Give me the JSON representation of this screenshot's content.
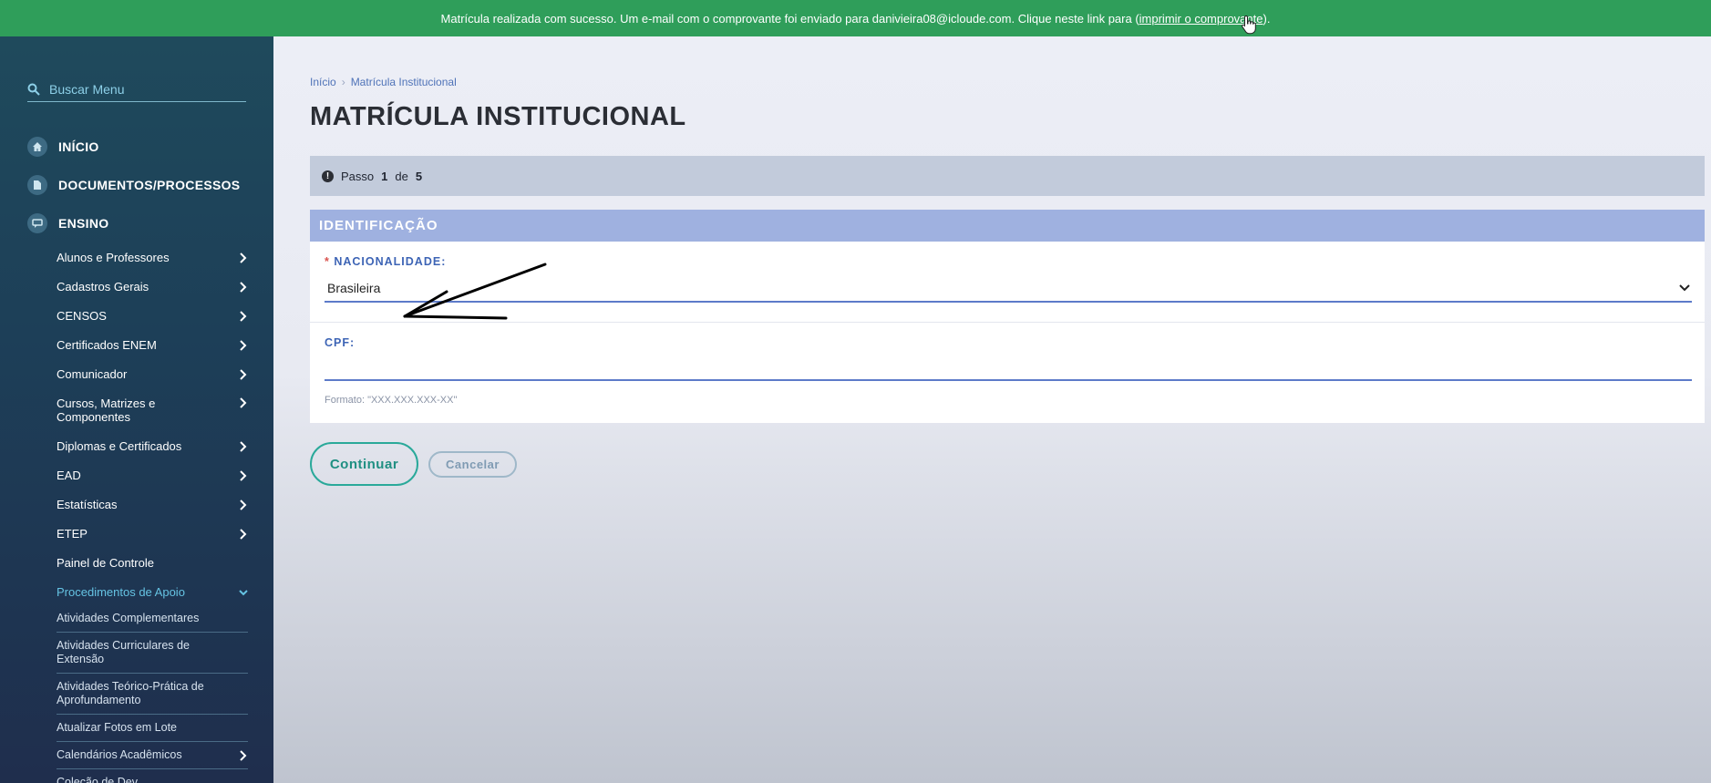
{
  "banner": {
    "message": "Matrícula realizada com sucesso. Um e-mail com o comprovante foi enviado para danivieira08@icloude.com. Clique neste link para (",
    "link": "imprimir o comprovante",
    "suffix": ")."
  },
  "sidebar": {
    "search_placeholder": "Buscar Menu",
    "top_items": [
      {
        "label": "INÍCIO",
        "icon": "home-icon"
      },
      {
        "label": "DOCUMENTOS/PROCESSOS",
        "icon": "file-icon"
      },
      {
        "label": "ENSINO",
        "icon": "chat-icon"
      }
    ],
    "sub_items": [
      {
        "label": "Alunos e Professores"
      },
      {
        "label": "Cadastros Gerais"
      },
      {
        "label": "CENSOS"
      },
      {
        "label": "Certificados ENEM"
      },
      {
        "label": "Comunicador"
      },
      {
        "label": "Cursos, Matrizes e Componentes"
      },
      {
        "label": "Diplomas e Certificados"
      },
      {
        "label": "EAD"
      },
      {
        "label": "Estatísticas"
      },
      {
        "label": "ETEP"
      },
      {
        "label": "Painel de Controle"
      },
      {
        "label": "Procedimentos de Apoio"
      }
    ],
    "subsub_items": [
      {
        "label": "Atividades Complementares"
      },
      {
        "label": "Atividades Curriculares de Extensão"
      },
      {
        "label": "Atividades Teórico-Prática de Aprofundamento"
      },
      {
        "label": "Atualizar Fotos em Lote"
      },
      {
        "label": "Calendários Acadêmicos"
      },
      {
        "label": "Coleção de Dev..."
      }
    ]
  },
  "breadcrumb": {
    "home": "Início",
    "current": "Matrícula Institucional"
  },
  "page_title": "MATRÍCULA INSTITUCIONAL",
  "step": {
    "prefix": "Passo",
    "current": "1",
    "of": "de",
    "total": "5"
  },
  "section": {
    "title": "IDENTIFICAÇÃO"
  },
  "form": {
    "nationality_label": "NACIONALIDADE:",
    "nationality_value": "Brasileira",
    "cpf_label": "CPF:",
    "cpf_value": "",
    "cpf_hint": "Formato: \"XXX.XXX.XXX-XX\""
  },
  "buttons": {
    "continue": "Continuar",
    "cancel": "Cancelar"
  },
  "colors": {
    "banner": "#2f9e5a",
    "accent": "#2aa99a",
    "section_header": "#9fb1e0"
  }
}
